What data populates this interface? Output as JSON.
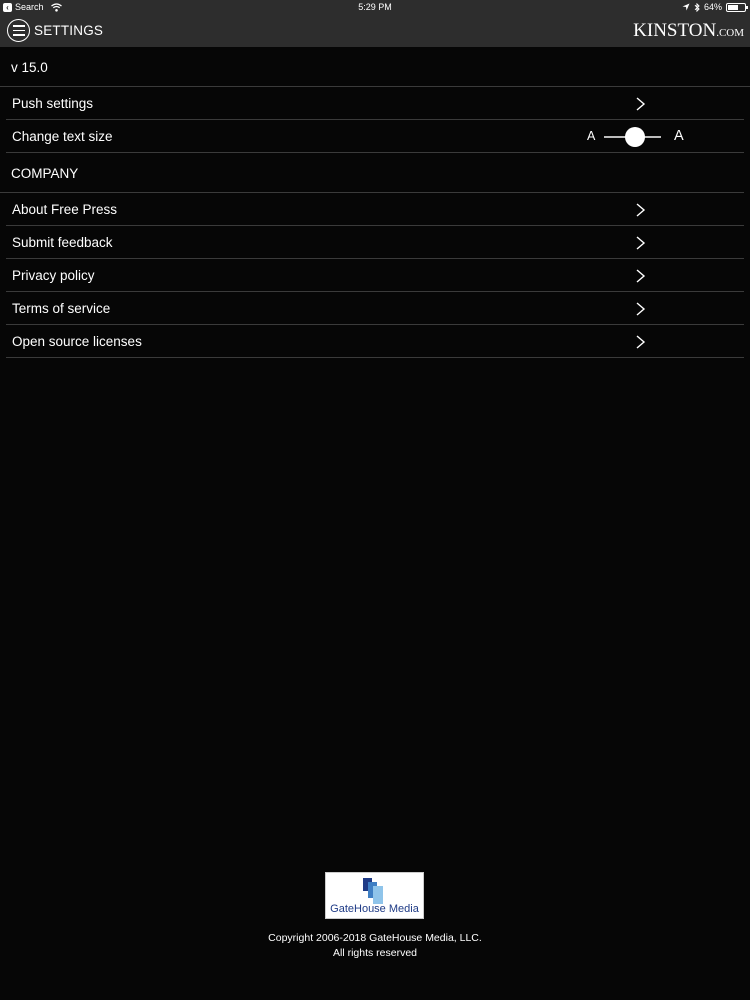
{
  "status_bar": {
    "back_label": "Search",
    "time": "5:29 PM",
    "battery_percent": "64%",
    "battery_level": 0.64
  },
  "header": {
    "title": "SETTINGS",
    "brand": "KINSTON",
    "brand_suffix": ".COM"
  },
  "version": "v 15.0",
  "rows_top": [
    {
      "label": "Push settings"
    },
    {
      "label": "Change text size",
      "slider": {
        "small_label": "A",
        "large_label": "A",
        "value": 0.55
      }
    }
  ],
  "company": {
    "header": "COMPANY",
    "items": [
      {
        "label": "About Free Press"
      },
      {
        "label": "Submit feedback"
      },
      {
        "label": "Privacy policy"
      },
      {
        "label": "Terms of service"
      },
      {
        "label": "Open source licenses"
      }
    ]
  },
  "footer": {
    "logo_text": "GateHouse Media",
    "copyright_line1": "Copyright 2006-2018 GateHouse Media, LLC.",
    "copyright_line2": "All rights reserved"
  },
  "colors": {
    "background": "#060606",
    "bar": "#2d2d2d",
    "divider": "#3a3a3a",
    "logo_blue": "#1f3b86"
  }
}
